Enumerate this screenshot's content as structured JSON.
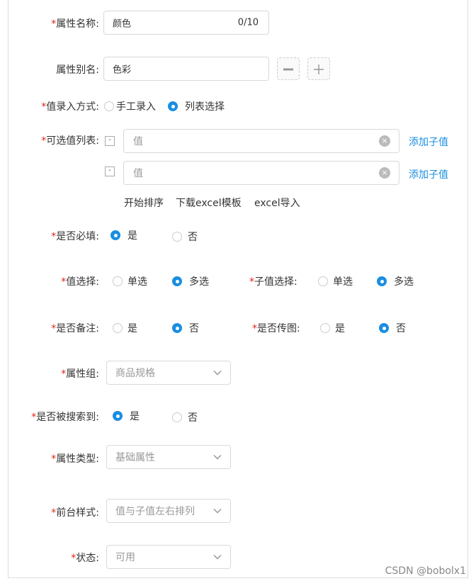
{
  "attr_name": {
    "label": "属性名称:",
    "value": "颜色",
    "count": "0/10"
  },
  "attr_alias": {
    "label": "属性别名:",
    "value": "色彩",
    "minus_icon": "minus-icon",
    "plus_icon": "plus-icon"
  },
  "input_mode": {
    "label": "值录入方式:",
    "options": [
      "手工录入",
      "列表选择"
    ],
    "selected": "列表选择"
  },
  "value_list": {
    "label": "可选值列表:",
    "rows": [
      {
        "placeholder": "值",
        "action": "添加子值"
      },
      {
        "placeholder": "值",
        "action": "添加子值"
      }
    ],
    "actions": [
      "开始排序",
      "下载excel模板",
      "excel导入"
    ]
  },
  "required": {
    "label": "是否必填:",
    "options": [
      "是",
      "否"
    ],
    "selected": "是"
  },
  "value_select": {
    "label": "值选择:",
    "options": [
      "单选",
      "多选"
    ],
    "selected": "多选"
  },
  "sub_value_select": {
    "label": "子值选择:",
    "options": [
      "单选",
      "多选"
    ],
    "selected": "多选"
  },
  "remark": {
    "label": "是否备注:",
    "options": [
      "是",
      "否"
    ],
    "selected": "否"
  },
  "upload_image": {
    "label": "是否传图:",
    "options": [
      "是",
      "否"
    ],
    "selected": "否"
  },
  "attr_group": {
    "label": "属性组:",
    "value": "商品规格"
  },
  "searchable": {
    "label": "是否被搜索到:",
    "options": [
      "是",
      "否"
    ],
    "selected": "是"
  },
  "attr_type": {
    "label": "属性类型:",
    "value": "基础属性"
  },
  "front_style": {
    "label": "前台样式:",
    "value": "值与子值左右排列"
  },
  "status": {
    "label": "状态:",
    "value": "可用"
  },
  "required_mark": "*",
  "accent_color": "#1a8ee1",
  "required_color": "#e0251a",
  "watermark": "CSDN @bobolx1"
}
